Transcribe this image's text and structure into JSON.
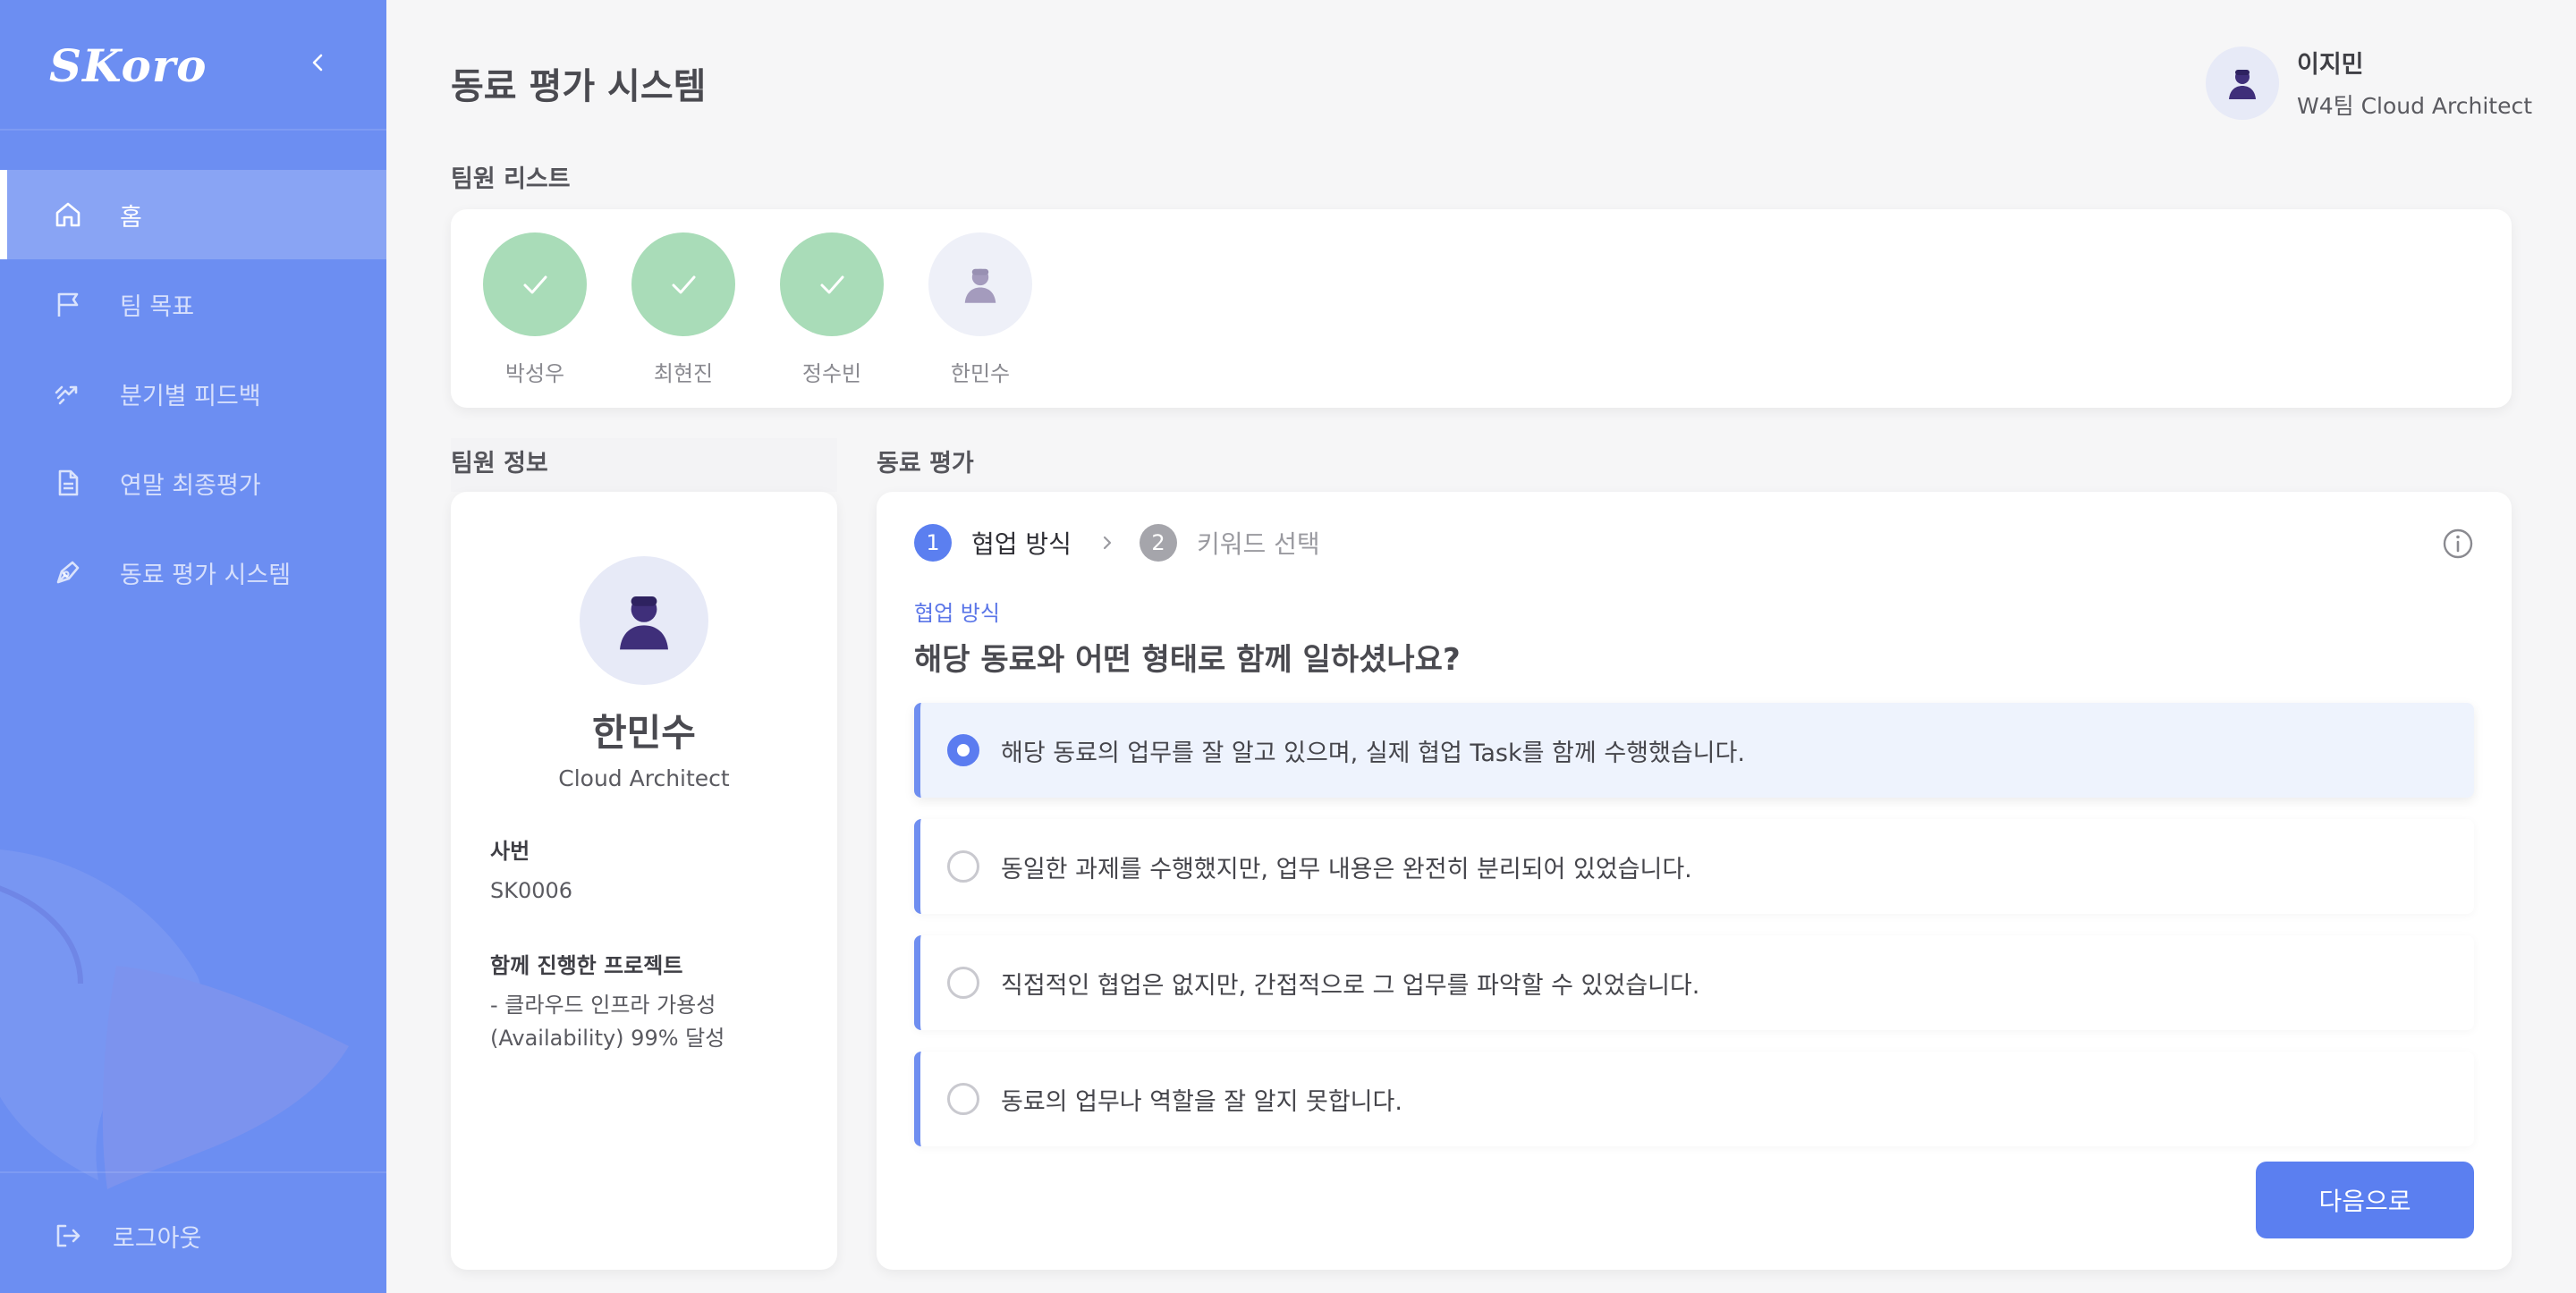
{
  "app": {
    "logo": "SKoro",
    "page_title": "동료 평가 시스템"
  },
  "sidebar": {
    "items": [
      {
        "label": "홈",
        "icon": "home-icon",
        "active": true
      },
      {
        "label": "팀 목표",
        "icon": "flag-icon",
        "active": false
      },
      {
        "label": "분기별 피드백",
        "icon": "feedback-icon",
        "active": false
      },
      {
        "label": "연말 최종평가",
        "icon": "document-icon",
        "active": false
      },
      {
        "label": "동료 평가 시스템",
        "icon": "pen-icon",
        "active": false
      }
    ],
    "logout_label": "로그아웃"
  },
  "user": {
    "name": "이지민",
    "role": "W4팀 Cloud Architect"
  },
  "team_list": {
    "label": "팀원 리스트",
    "members": [
      {
        "name": "박성우",
        "status": "done"
      },
      {
        "name": "최현진",
        "status": "done"
      },
      {
        "name": "정수빈",
        "status": "done"
      },
      {
        "name": "한민수",
        "status": "pending"
      }
    ]
  },
  "member_info": {
    "label": "팀원 정보",
    "name": "한민수",
    "role": "Cloud Architect",
    "employee_id_label": "사번",
    "employee_id": "SK0006",
    "projects_label": "함께 진행한 프로젝트",
    "projects": "- 클라우드 인프라 가용성 (Availability) 99% 달성"
  },
  "evaluation": {
    "label": "동료 평가",
    "steps": [
      {
        "num": "1",
        "label": "협업 방식",
        "active": true
      },
      {
        "num": "2",
        "label": "키워드 선택",
        "active": false
      }
    ],
    "category": "협업 방식",
    "question": "해당 동료와 어떤 형태로 함께 일하셨나요?",
    "options": [
      {
        "text": "해당 동료의 업무를 잘 알고 있으며, 실제 협업 Task를 함께 수행했습니다.",
        "selected": true
      },
      {
        "text": "동일한 과제를 수행했지만, 업무 내용은 완전히 분리되어 있었습니다.",
        "selected": false
      },
      {
        "text": "직접적인 협업은 없지만, 간접적으로 그 업무를 파악할 수 있었습니다.",
        "selected": false
      },
      {
        "text": "동료의 업무나 역할을 잘 알지 못합니다.",
        "selected": false
      }
    ],
    "next_label": "다음으로"
  },
  "colors": {
    "sidebar": "#6c8ef2",
    "accent": "#5b7ff0",
    "done": "#a9dcb8"
  }
}
